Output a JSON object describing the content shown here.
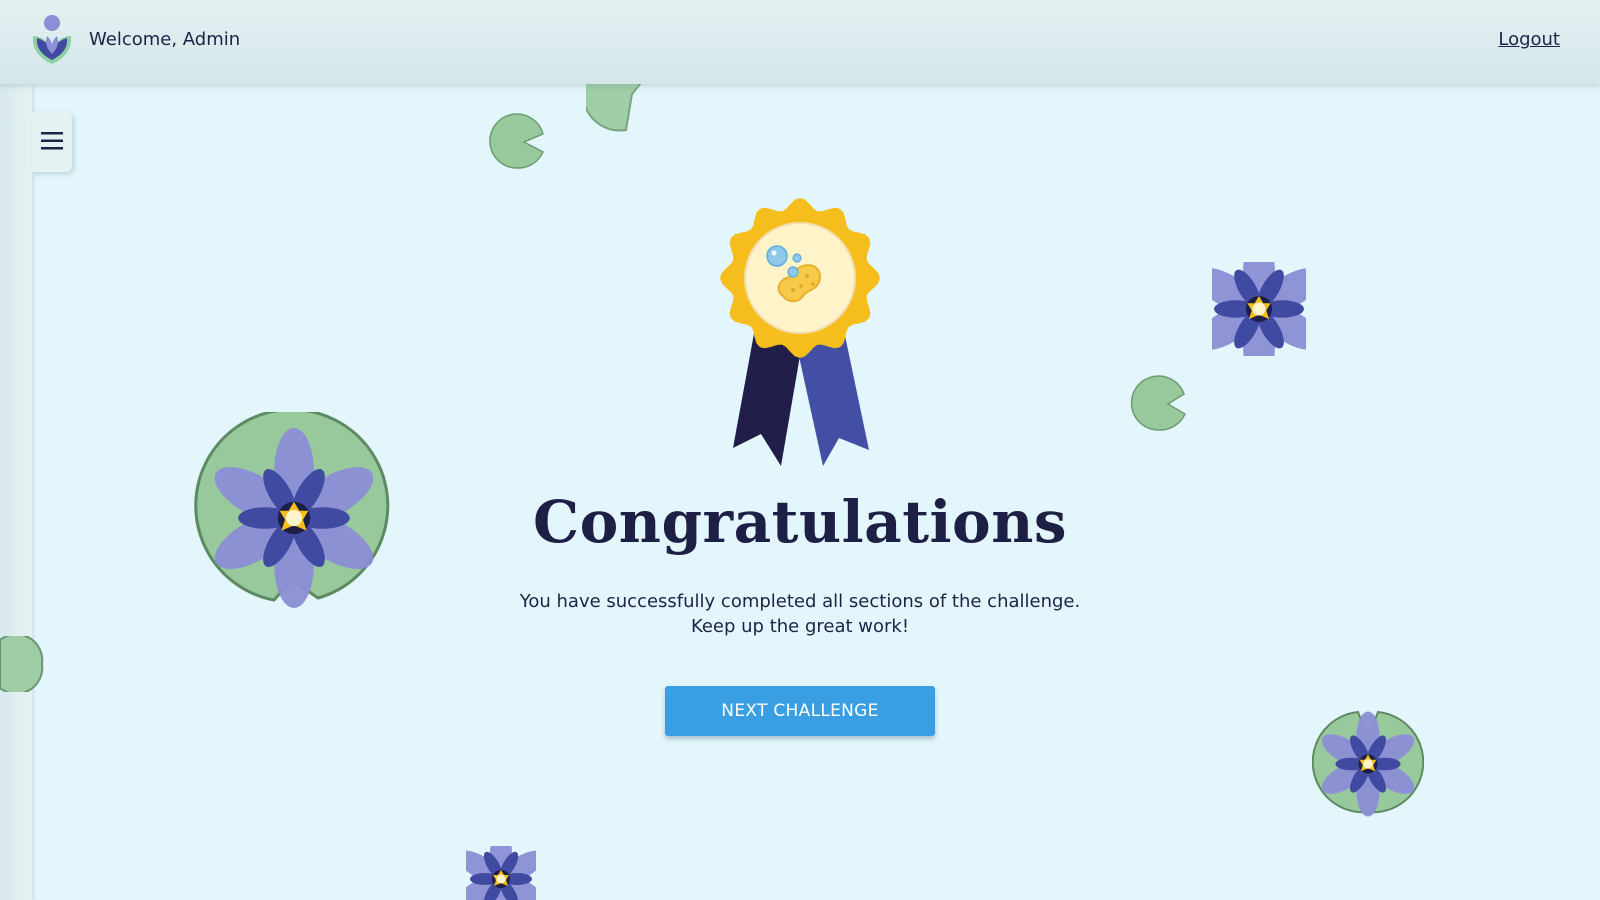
{
  "header": {
    "welcome_text": "Welcome, Admin",
    "logout_label": "Logout"
  },
  "sidebar": {
    "menu_icon": "hamburger-menu-icon"
  },
  "main": {
    "badge_icon": "award-medal-icon",
    "title": "Congratulations",
    "message_line1": "You have successfully completed all sections of the challenge.",
    "message_line2": "Keep up the great work!",
    "next_button_label": "NEXT CHALLENGE"
  },
  "colors": {
    "background": "#e2f6fb",
    "header": "#d3e6e8",
    "accent_button": "#3a9fe2",
    "title_text": "#1e1f45",
    "lily_pad": "#98c99c",
    "flower_petal": "#8b8fd6",
    "flower_inner": "#3f4aa0",
    "medal_gold": "#f5be1d",
    "ribbon_dark": "#211f4a",
    "ribbon_blue": "#434fa5"
  }
}
